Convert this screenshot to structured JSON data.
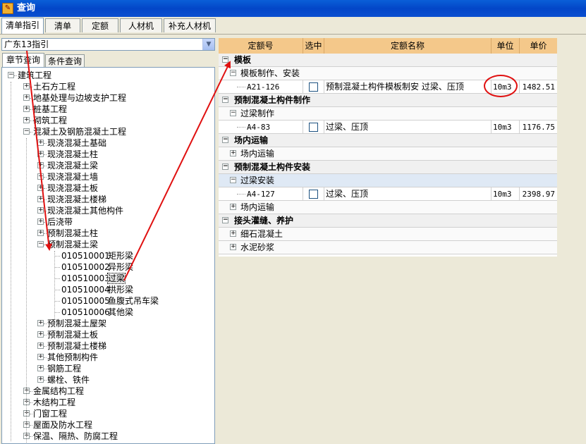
{
  "window": {
    "title": "查询"
  },
  "top_tabs": [
    "清单指引",
    "清单",
    "定额",
    "人材机",
    "补充人材机"
  ],
  "guide_select": {
    "value": "广东13指引"
  },
  "sub_tabs": [
    "章节查询",
    "条件查询"
  ],
  "tree": [
    {
      "label": "建筑工程",
      "level": 0,
      "state": "minus"
    },
    {
      "label": "土石方工程",
      "level": 1,
      "state": "plus"
    },
    {
      "label": "地基处理与边坡支护工程",
      "level": 1,
      "state": "plus"
    },
    {
      "label": "桩基工程",
      "level": 1,
      "state": "plus"
    },
    {
      "label": "砌筑工程",
      "level": 1,
      "state": "plus"
    },
    {
      "label": "混凝土及钢筋混凝土工程",
      "level": 1,
      "state": "minus"
    },
    {
      "label": "现浇混凝土基础",
      "level": 2,
      "state": "plus"
    },
    {
      "label": "现浇混凝土柱",
      "level": 2,
      "state": "plus"
    },
    {
      "label": "现浇混凝土梁",
      "level": 2,
      "state": "plus"
    },
    {
      "label": "现浇混凝土墙",
      "level": 2,
      "state": "plus"
    },
    {
      "label": "现浇混凝土板",
      "level": 2,
      "state": "plus"
    },
    {
      "label": "现浇混凝土楼梯",
      "level": 2,
      "state": "plus"
    },
    {
      "label": "现浇混凝土其他构件",
      "level": 2,
      "state": "plus"
    },
    {
      "label": "后浇带",
      "level": 2,
      "state": "plus"
    },
    {
      "label": "预制混凝土柱",
      "level": 2,
      "state": "plus"
    },
    {
      "label": "预制混凝土梁",
      "level": 2,
      "state": "minus"
    },
    {
      "code": "010510001",
      "label": "矩形梁",
      "level": 3,
      "state": "leaf"
    },
    {
      "code": "010510002",
      "label": "异形梁",
      "level": 3,
      "state": "leaf"
    },
    {
      "code": "010510003",
      "label": "过梁",
      "level": 3,
      "state": "leaf",
      "selected": true
    },
    {
      "code": "010510004",
      "label": "拱形梁",
      "level": 3,
      "state": "leaf"
    },
    {
      "code": "010510005",
      "label": "鱼腹式吊车梁",
      "level": 3,
      "state": "leaf"
    },
    {
      "code": "010510006",
      "label": "其他梁",
      "level": 3,
      "state": "leaf"
    },
    {
      "label": "预制混凝土屋架",
      "level": 2,
      "state": "plus"
    },
    {
      "label": "预制混凝土板",
      "level": 2,
      "state": "plus"
    },
    {
      "label": "预制混凝土楼梯",
      "level": 2,
      "state": "plus"
    },
    {
      "label": "其他预制构件",
      "level": 2,
      "state": "plus"
    },
    {
      "label": "钢筋工程",
      "level": 2,
      "state": "plus"
    },
    {
      "label": "螺栓、铁件",
      "level": 2,
      "state": "plus"
    },
    {
      "label": "金属结构工程",
      "level": 1,
      "state": "plus"
    },
    {
      "label": "木结构工程",
      "level": 1,
      "state": "plus"
    },
    {
      "label": "门窗工程",
      "level": 1,
      "state": "plus"
    },
    {
      "label": "屋面及防水工程",
      "level": 1,
      "state": "plus"
    },
    {
      "label": "保温、隔热、防腐工程",
      "level": 1,
      "state": "plus"
    }
  ],
  "quota_table": {
    "headers": [
      "定额号",
      "选中",
      "定额名称",
      "单位",
      "单价"
    ],
    "rows": [
      {
        "kind": "group1",
        "label": "模板"
      },
      {
        "kind": "group2",
        "label": "模板制作、安装",
        "state": "minus"
      },
      {
        "kind": "item",
        "code": "A21-126",
        "name": "预制混凝土构件模板制安 过梁、压顶",
        "unit": "10m3",
        "price": "1482.51"
      },
      {
        "kind": "group1",
        "label": "预制混凝土构件制作"
      },
      {
        "kind": "group2",
        "label": "过梁制作",
        "state": "minus"
      },
      {
        "kind": "item",
        "code": "A4-83",
        "name": "过梁、压顶",
        "unit": "10m3",
        "price": "1176.75"
      },
      {
        "kind": "group1",
        "label": "场内运输"
      },
      {
        "kind": "group2",
        "label": "场内运输",
        "state": "plus"
      },
      {
        "kind": "group1",
        "label": "预制混凝土构件安装"
      },
      {
        "kind": "group2",
        "label": "过梁安装",
        "state": "minus",
        "highlight": true
      },
      {
        "kind": "item",
        "code": "A4-127",
        "name": "过梁、压顶",
        "unit": "10m3",
        "price": "2398.97"
      },
      {
        "kind": "group2",
        "label": "场内运输",
        "state": "plus"
      },
      {
        "kind": "group1",
        "label": "接头灌缝、养护"
      },
      {
        "kind": "group2",
        "label": "细石混凝土",
        "state": "plus"
      },
      {
        "kind": "group2",
        "label": "水泥砂浆",
        "state": "plus"
      }
    ]
  },
  "colors": {
    "titlebar": "#0346c8",
    "header": "#f4c88a",
    "annotation": "#e01010"
  }
}
